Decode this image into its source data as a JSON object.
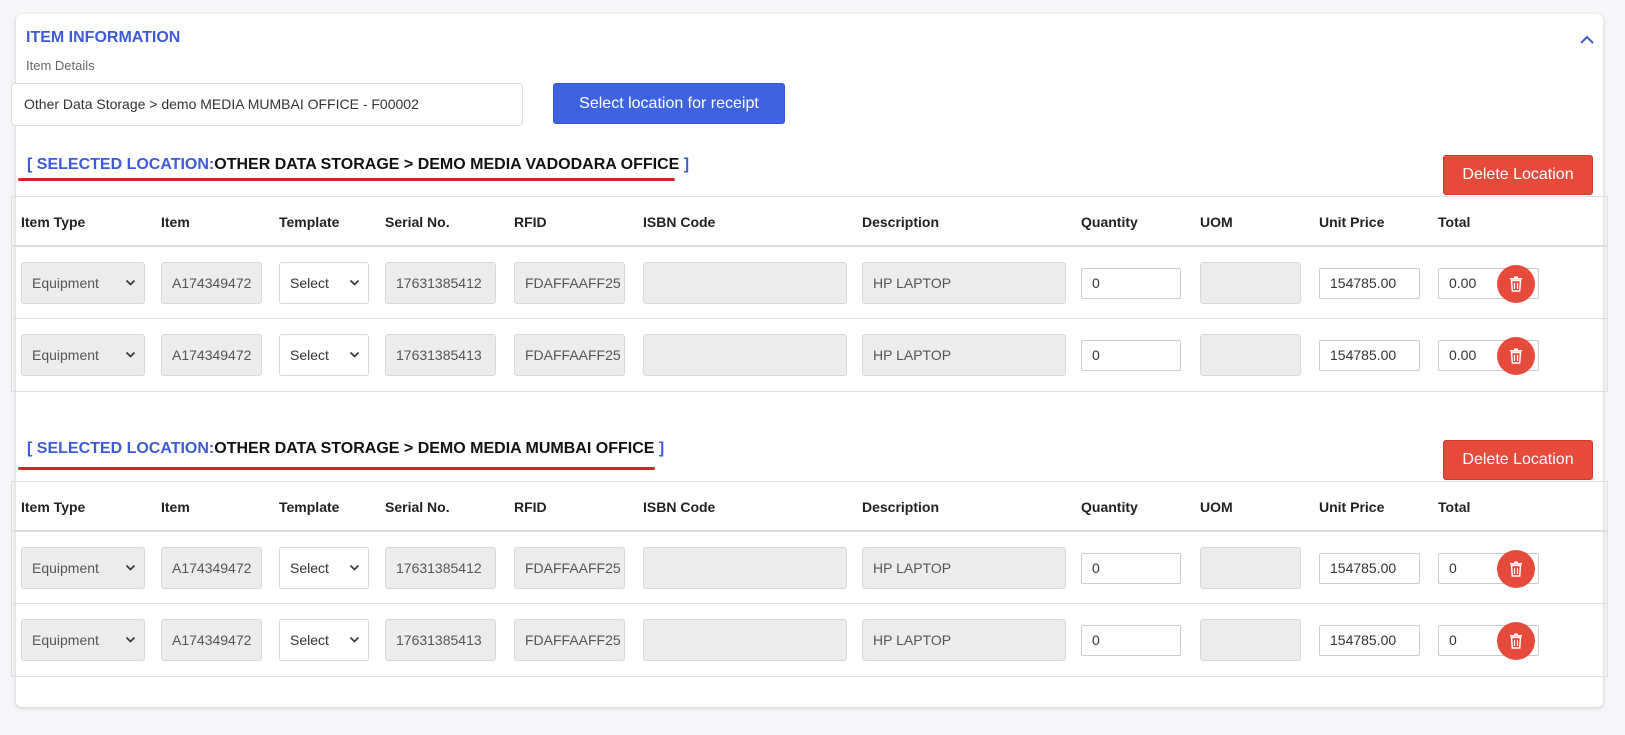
{
  "section": {
    "title": "ITEM INFORMATION",
    "subtitle": "Item Details"
  },
  "location_picker": {
    "value": "Other Data Storage > demo MEDIA MUMBAI OFFICE - F00002",
    "button_label": "Select location for receipt"
  },
  "columns": [
    "Item Type",
    "Item",
    "Template",
    "Serial No.",
    "RFID",
    "ISBN Code",
    "Description",
    "Quantity",
    "UOM",
    "Unit Price",
    "Total"
  ],
  "locations": [
    {
      "label_prefix": "SELECTED LOCATION:",
      "name": "OTHER DATA STORAGE > DEMO MEDIA VADODARA OFFICE",
      "delete_label": "Delete Location",
      "rows": [
        {
          "item_type": "Equipment",
          "item": "A174349472",
          "template": "Select",
          "serial": "17631385412",
          "rfid": "FDAFFAAFF25",
          "isbn": "",
          "description": "HP LAPTOP",
          "quantity": "0",
          "uom": "",
          "unit_price": "154785.00",
          "total": "0.00"
        },
        {
          "item_type": "Equipment",
          "item": "A174349472",
          "template": "Select",
          "serial": "17631385413",
          "rfid": "FDAFFAAFF25",
          "isbn": "",
          "description": "HP LAPTOP",
          "quantity": "0",
          "uom": "",
          "unit_price": "154785.00",
          "total": "0.00"
        }
      ]
    },
    {
      "label_prefix": "SELECTED LOCATION:",
      "name": "OTHER DATA STORAGE > DEMO MEDIA MUMBAI OFFICE",
      "delete_label": "Delete Location",
      "rows": [
        {
          "item_type": "Equipment",
          "item": "A174349472",
          "template": "Select",
          "serial": "17631385412",
          "rfid": "FDAFFAAFF25",
          "isbn": "",
          "description": "HP LAPTOP",
          "quantity": "0",
          "uom": "",
          "unit_price": "154785.00",
          "total": "0"
        },
        {
          "item_type": "Equipment",
          "item": "A174349472",
          "template": "Select",
          "serial": "17631385413",
          "rfid": "FDAFFAAFF25",
          "isbn": "",
          "description": "HP LAPTOP",
          "quantity": "0",
          "uom": "",
          "unit_price": "154785.00",
          "total": "0"
        }
      ]
    }
  ],
  "colors": {
    "accent": "#3d5bd9",
    "danger": "#e64a3b",
    "underline": "#d9252a"
  }
}
